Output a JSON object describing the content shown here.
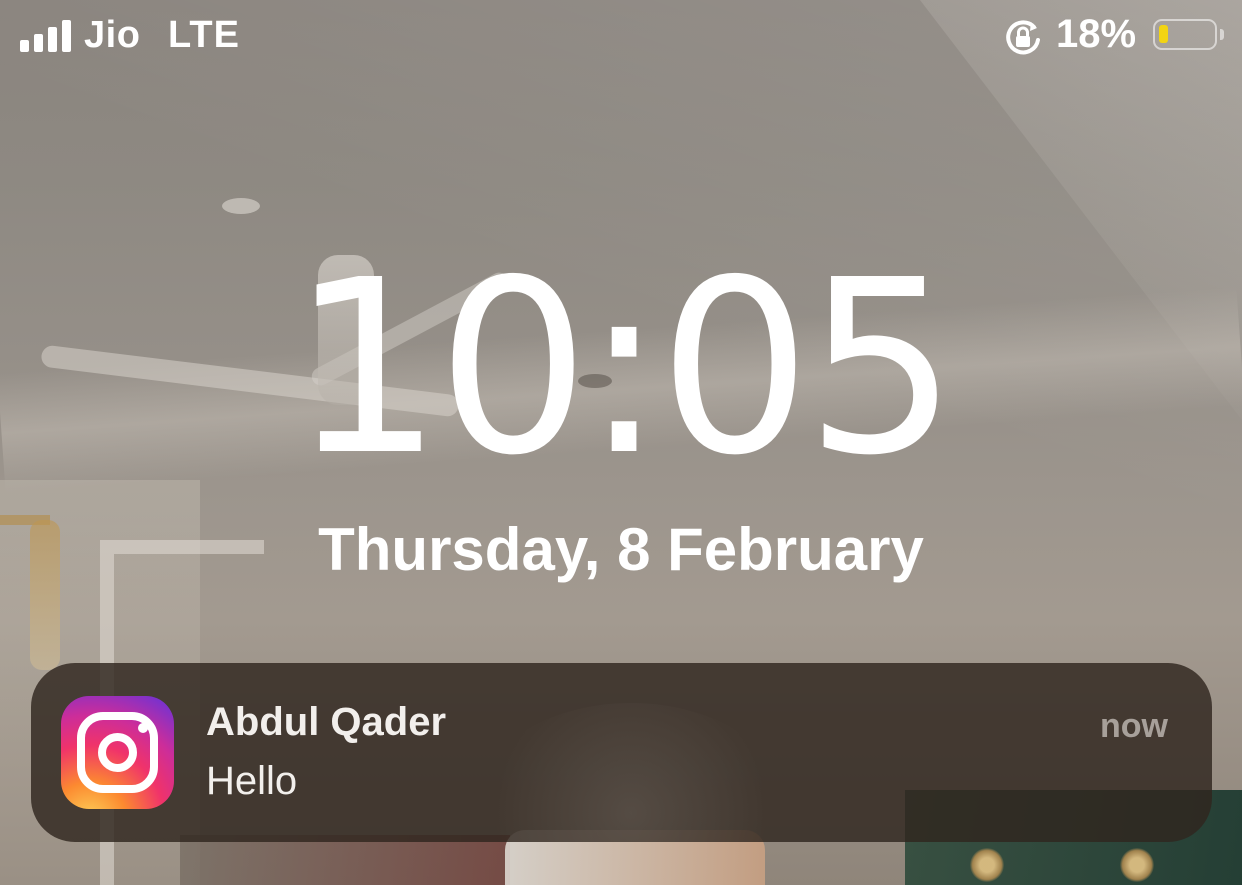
{
  "status_bar": {
    "carrier": "Jio",
    "network": "LTE",
    "signal_bars": 4,
    "battery_percent": "18%",
    "battery_level": 0.18,
    "battery_color": "#f2d413",
    "rotation_lock_icon": "rotation-lock-icon"
  },
  "lock_screen": {
    "time": "10:05",
    "date": "Thursday, 8 February"
  },
  "notification": {
    "app_icon": "instagram-icon",
    "sender": "Abdul Qader",
    "message": "Hello",
    "timestamp": "now"
  }
}
